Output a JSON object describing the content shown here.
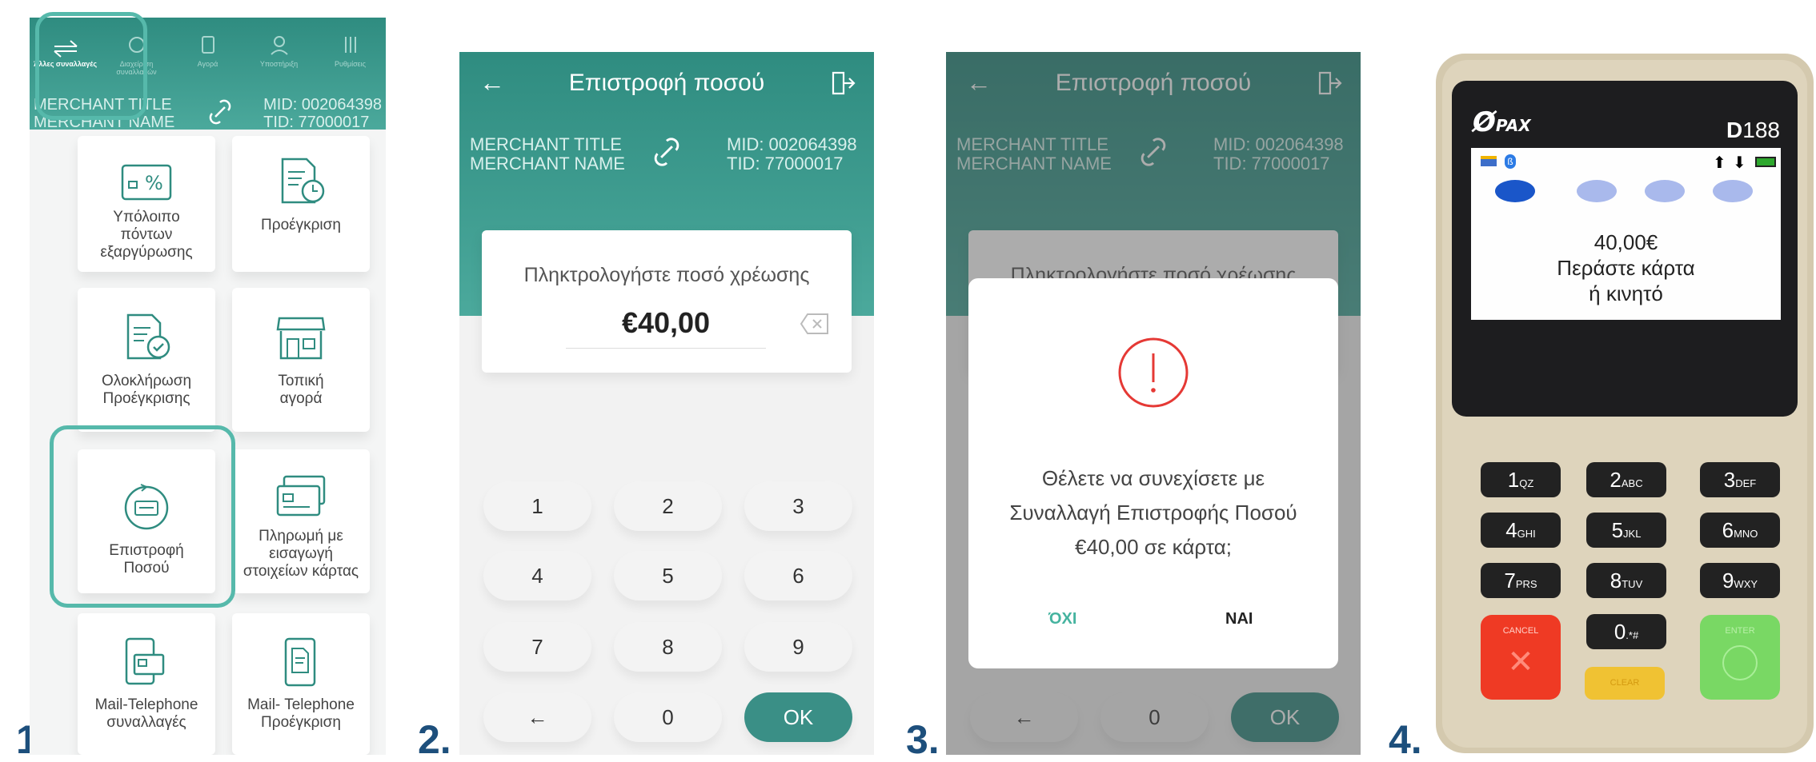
{
  "steps": [
    "1.",
    "2.",
    "3.",
    "4."
  ],
  "panel1": {
    "tabs": [
      "Άλλες συναλλαγές",
      "Διαχείριση συναλλαγών",
      "Αγορά",
      "Υποστήριξη",
      "Ρυθμίσεις"
    ],
    "merchant_title": "MERCHANT TITLE",
    "merchant_name": "MERCHANT NAME",
    "mid": "MID: 002064398",
    "tid": "TID: 77000017",
    "tiles": [
      {
        "l1": "Υπόλοιπο",
        "l2": "πόντων",
        "l3": "εξαργύρωσης",
        "icon": "points-percent-icon"
      },
      {
        "l1": "Προέγκριση",
        "icon": "document-clock-icon"
      },
      {
        "l1": "Ολοκλήρωση",
        "l2": "Προέγκρισης",
        "icon": "document-check-icon"
      },
      {
        "l1": "Τοπική",
        "l2": "αγορά",
        "icon": "store-icon"
      },
      {
        "l1": "Επιστροφή",
        "l2": "Ποσού",
        "icon": "refund-card-icon"
      },
      {
        "l1": "Πληρωμή με",
        "l2": "εισαγωγή",
        "l3": "στοιχείων κάρτας",
        "icon": "cards-icon"
      },
      {
        "l1": "Mail-Telephone",
        "l2": "συναλλαγές",
        "icon": "phone-card-icon"
      },
      {
        "l1": "Mail- Telephone",
        "l2": "Προέγκριση",
        "icon": "phone-doc-icon"
      }
    ]
  },
  "panel2": {
    "title": "Επιστροφή ποσού",
    "merchant_title": "MERCHANT TITLE",
    "merchant_name": "MERCHANT NAME",
    "mid": "MID: 002064398",
    "tid": "TID: 77000017",
    "prompt": "Πληκτρολογήστε ποσό χρέωσης",
    "amount": "€40,00",
    "keys": [
      "1",
      "2",
      "3",
      "4",
      "5",
      "6",
      "7",
      "8",
      "9",
      "←",
      "0",
      "OK"
    ]
  },
  "panel3": {
    "title": "Επιστροφή ποσού",
    "merchant_title": "MERCHANT TITLE",
    "merchant_name": "MERCHANT NAME",
    "mid": "MID: 002064398",
    "tid": "TID: 77000017",
    "prompt": "Πληκτρολογήστε ποσό χρέωσης",
    "question_l1": "Θέλετε να συνεχίσετε με",
    "question_l2": "Συναλλαγή Επιστροφής Ποσού",
    "question_l3": "€40,00 σε κάρτα;",
    "no": "ΌΧΙ",
    "yes": "ΝΑΙ",
    "keys": [
      "←",
      "0",
      "OK"
    ]
  },
  "terminal": {
    "brand": "PAX",
    "model_prefix": "D",
    "model_num": "188",
    "amount": "40,00€",
    "line1": "Περάστε κάρτα",
    "line2": "ή κινητό",
    "keys": [
      [
        "1",
        "QZ"
      ],
      [
        "2",
        "ABC"
      ],
      [
        "3",
        "DEF"
      ],
      [
        "4",
        "GHI"
      ],
      [
        "5",
        "JKL"
      ],
      [
        "6",
        "MNO"
      ],
      [
        "7",
        "PRS"
      ],
      [
        "8",
        "TUV"
      ],
      [
        "9",
        "WXY"
      ],
      [
        "0",
        ".*#"
      ]
    ],
    "cancel": "CANCEL",
    "clear": "CLEAR",
    "enter": "ENTER"
  },
  "colors": {
    "teal": "#2f8c80",
    "highlight": "#56b9ab",
    "step": "#1d4f7c",
    "alert": "#e53935"
  }
}
